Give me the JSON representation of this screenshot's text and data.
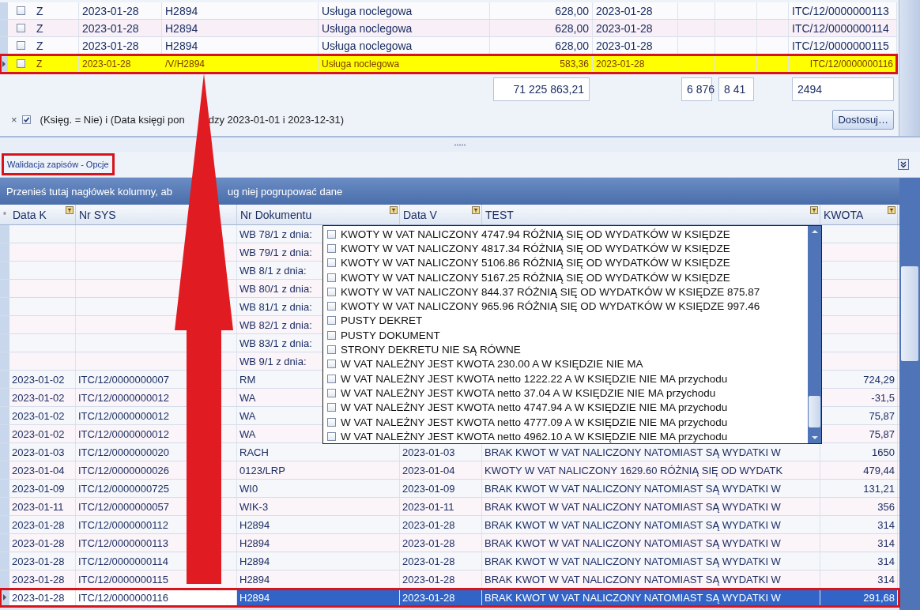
{
  "top_grid": {
    "rows": [
      {
        "selected": false,
        "marked": false,
        "checked": false,
        "type": "Z",
        "date": "2023-01-28",
        "document": "H2894",
        "description": "Usługa noclegowa",
        "amount": "628,00",
        "date_2": "2023-01-28",
        "reference": "ITC/12/0000000113"
      },
      {
        "selected": false,
        "marked": false,
        "checked": false,
        "type": "Z",
        "date": "2023-01-28",
        "document": "H2894",
        "description": "Usługa noclegowa",
        "amount": "628,00",
        "date_2": "2023-01-28",
        "reference": "ITC/12/0000000114"
      },
      {
        "selected": false,
        "marked": false,
        "checked": false,
        "type": "Z",
        "date": "2023-01-28",
        "document": "H2894",
        "description": "Usługa noclegowa",
        "amount": "628,00",
        "date_2": "2023-01-28",
        "reference": "ITC/12/0000000115"
      },
      {
        "selected": true,
        "marked": true,
        "checked": false,
        "type": "Z",
        "date": "2023-01-28",
        "document": "/V/H2894",
        "description": "Usługa noclegowa",
        "amount": "583,36",
        "date_2": "2023-01-28",
        "reference": "ITC/12/0000000116"
      }
    ],
    "totals": [
      "71 225 863,21",
      "6 876",
      "8 41",
      "2494"
    ],
    "filter": {
      "clear": "×",
      "enabled": true,
      "text_parts": [
        "(Księg. = Nie) i (Data księgi pon",
        "dzy 2023-01-01 i 2023-12-31)"
      ]
    },
    "customize_button": "Dostosuj…"
  },
  "validation_panel": {
    "title": "Walidacja zapisów - Opcje",
    "marked": true,
    "group_panel_parts": [
      "Przenieś tutaj nagłówek kolumny, ab",
      "ug niej pogrupować dane"
    ],
    "new_row_marker": "*",
    "columns": [
      {
        "label": "Data K",
        "filter": true
      },
      {
        "label": "Nr SYS",
        "filter": false
      },
      {
        "label": "Nr Dokumentu",
        "filter": true
      },
      {
        "label": "Data V",
        "filter": true
      },
      {
        "label": "TEST",
        "filter": true
      },
      {
        "label": "KWOTA",
        "filter": true
      }
    ],
    "rows": [
      {
        "selected": false,
        "marked": false,
        "document": "WB 78/1 z dnia:"
      },
      {
        "selected": false,
        "marked": false,
        "document": "WB 79/1 z dnia:"
      },
      {
        "selected": false,
        "marked": false,
        "document": "WB 8/1 z dnia:"
      },
      {
        "selected": false,
        "marked": false,
        "document": "WB 80/1 z dnia:"
      },
      {
        "selected": false,
        "marked": false,
        "document": "WB 81/1 z dnia:"
      },
      {
        "selected": false,
        "marked": false,
        "document": "WB 82/1 z dnia:"
      },
      {
        "selected": false,
        "marked": false,
        "document": "WB 83/1 z dnia:"
      },
      {
        "selected": false,
        "marked": false,
        "document": "WB 9/1 z dnia:"
      },
      {
        "selected": false,
        "marked": false,
        "data_k": "2023-01-02",
        "nr_sys": "ITC/12/0000000007",
        "document": "RM",
        "kwota": "724,29"
      },
      {
        "selected": false,
        "marked": false,
        "data_k": "2023-01-02",
        "nr_sys": "ITC/12/0000000012",
        "document": "WA",
        "kwota": "-31,5"
      },
      {
        "selected": false,
        "marked": false,
        "data_k": "2023-01-02",
        "nr_sys": "ITC/12/0000000012",
        "document": "WA",
        "kwota": "75,87"
      },
      {
        "selected": false,
        "marked": false,
        "data_k": "2023-01-02",
        "nr_sys": "ITC/12/0000000012",
        "document": "WA",
        "kwota": "75,87"
      },
      {
        "selected": false,
        "marked": false,
        "data_k": "2023-01-03",
        "nr_sys": "ITC/12/0000000020",
        "document": "RACH",
        "data_v": "2023-01-03",
        "test": "BRAK KWOT W VAT NALICZONY NATOMIAST SĄ WYDATKI W",
        "kwota": "1650"
      },
      {
        "selected": false,
        "marked": false,
        "data_k": "2023-01-04",
        "nr_sys": "ITC/12/0000000026",
        "document": "0123/LRP",
        "data_v": "2023-01-04",
        "test": "KWOTY W VAT NALICZONY 1629.60 RÓŻNIĄ SIĘ OD WYDATK",
        "kwota": "479,44"
      },
      {
        "selected": false,
        "marked": false,
        "data_k": "2023-01-09",
        "nr_sys": "ITC/12/0000000725",
        "document": "WI0",
        "data_v": "2023-01-09",
        "test": "BRAK KWOT W VAT NALICZONY NATOMIAST SĄ WYDATKI W",
        "kwota": "131,21"
      },
      {
        "selected": false,
        "marked": false,
        "data_k": "2023-01-11",
        "nr_sys": "ITC/12/0000000057",
        "document": "WIK-3",
        "data_v": "2023-01-11",
        "test": "BRAK KWOT W VAT NALICZONY NATOMIAST SĄ WYDATKI W",
        "kwota": "356"
      },
      {
        "selected": false,
        "marked": false,
        "data_k": "2023-01-28",
        "nr_sys": "ITC/12/0000000112",
        "document": "H2894",
        "data_v": "2023-01-28",
        "test": "BRAK KWOT W VAT NALICZONY NATOMIAST SĄ WYDATKI W",
        "kwota": "314"
      },
      {
        "selected": false,
        "marked": false,
        "data_k": "2023-01-28",
        "nr_sys": "ITC/12/0000000113",
        "document": "H2894",
        "data_v": "2023-01-28",
        "test": "BRAK KWOT W VAT NALICZONY NATOMIAST SĄ WYDATKI W",
        "kwota": "314"
      },
      {
        "selected": false,
        "marked": false,
        "data_k": "2023-01-28",
        "nr_sys": "ITC/12/0000000114",
        "document": "H2894",
        "data_v": "2023-01-28",
        "test": "BRAK KWOT W VAT NALICZONY NATOMIAST SĄ WYDATKI W",
        "kwota": "314"
      },
      {
        "selected": false,
        "marked": false,
        "data_k": "2023-01-28",
        "nr_sys": "ITC/12/0000000115",
        "document": "H2894",
        "data_v": "2023-01-28",
        "test": "BRAK KWOT W VAT NALICZONY NATOMIAST SĄ WYDATKI W",
        "kwota": "314"
      },
      {
        "selected": true,
        "marked": true,
        "data_k": "2023-01-28",
        "nr_sys": "ITC/12/0000000116",
        "document": "H2894",
        "data_v": "2023-01-28",
        "test": "BRAK KWOT W VAT NALICZONY NATOMIAST SĄ WYDATKI W",
        "kwota": "291,68"
      }
    ],
    "dropdown": {
      "items": [
        {
          "checked": false,
          "label": "KWOTY W VAT NALICZONY 4747.94 RÓŻNIĄ SIĘ OD WYDATKÓW W KSIĘDZE"
        },
        {
          "checked": false,
          "label": "KWOTY W VAT NALICZONY 4817.34 RÓŻNIĄ SIĘ OD WYDATKÓW W KSIĘDZE"
        },
        {
          "checked": false,
          "label": "KWOTY W VAT NALICZONY 5106.86 RÓŻNIĄ SIĘ OD WYDATKÓW W KSIĘDZE"
        },
        {
          "checked": false,
          "label": "KWOTY W VAT NALICZONY 5167.25 RÓŻNIĄ SIĘ OD WYDATKÓW W KSIĘDZE"
        },
        {
          "checked": false,
          "label": "KWOTY W VAT NALICZONY 844.37 RÓŻNIĄ SIĘ OD WYDATKÓW W KSIĘDZE 875.87"
        },
        {
          "checked": false,
          "label": "KWOTY W VAT NALICZONY 965.96 RÓŻNIĄ SIĘ OD WYDATKÓW W KSIĘDZE 997.46"
        },
        {
          "checked": false,
          "label": "PUSTY DEKRET"
        },
        {
          "checked": false,
          "label": "PUSTY DOKUMENT"
        },
        {
          "checked": false,
          "label": "STRONY DEKRETU NIE SĄ RÓWNE"
        },
        {
          "checked": false,
          "label": "W VAT NALEŻNY JEST KWOTA 230.00 A W KSIĘDZIE NIE MA"
        },
        {
          "checked": false,
          "label": "W VAT NALEŻNY JEST KWOTA netto 1222.22 A W KSIĘDZIE NIE MA przychodu"
        },
        {
          "checked": false,
          "label": "W VAT NALEŻNY JEST KWOTA netto 37.04 A W KSIĘDZIE NIE MA przychodu"
        },
        {
          "checked": false,
          "label": "W VAT NALEŻNY JEST KWOTA netto 4747.94 A W KSIĘDZIE NIE MA przychodu"
        },
        {
          "checked": false,
          "label": "W VAT NALEŻNY JEST KWOTA netto 4777.09 A W KSIĘDZIE NIE MA przychodu"
        },
        {
          "checked": false,
          "label": "W VAT NALEŻNY JEST KWOTA netto 4962.10 A W KSIĘDZIE NIE MA przychodu"
        }
      ]
    }
  }
}
